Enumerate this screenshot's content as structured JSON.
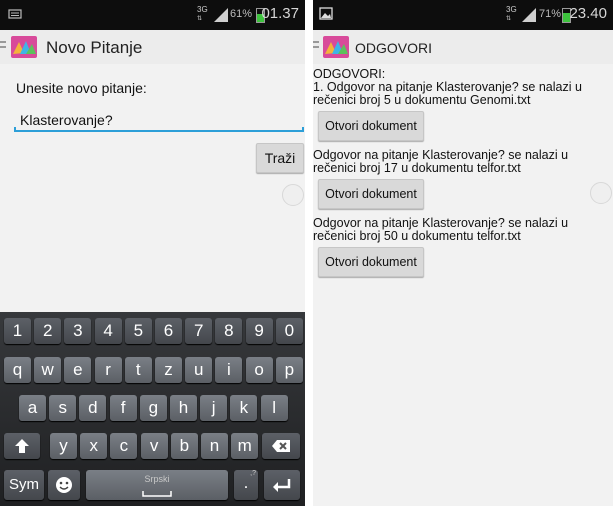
{
  "left_screen": {
    "status": {
      "network": "3G",
      "signal": "signal-bars-icon",
      "battery_pct": "61%",
      "battery_level": 0.61,
      "time": "01.37"
    },
    "action_bar": {
      "title": "Novo Pitanje"
    },
    "prompt_label": "Unesite novo pitanje:",
    "question_input": {
      "value": "Klasterovanje?"
    },
    "search_button": "Traži",
    "keyboard": {
      "number_row": [
        "1",
        "2",
        "3",
        "4",
        "5",
        "6",
        "7",
        "8",
        "9",
        "0"
      ],
      "row1": [
        "q",
        "w",
        "e",
        "r",
        "t",
        "z",
        "u",
        "i",
        "o",
        "p"
      ],
      "row2": [
        "a",
        "s",
        "d",
        "f",
        "g",
        "h",
        "j",
        "k",
        "l"
      ],
      "row3": [
        "y",
        "x",
        "c",
        "v",
        "b",
        "n",
        "m"
      ],
      "shift_key": "shift-arrow-icon",
      "backspace_key": "backspace-icon",
      "sym_label": "Sym",
      "emoji_key": "smiley-icon",
      "space_label": "Srpski",
      "punct_key": ".",
      "punct_sub": ",?",
      "enter_key": "enter-icon"
    }
  },
  "right_screen": {
    "status": {
      "network": "3G",
      "signal": "signal-bars-icon",
      "battery_pct": "71%",
      "battery_level": 0.71,
      "time": "23.40",
      "notification": "image-icon"
    },
    "action_bar": {
      "title": "ODGOVORI"
    },
    "header": "ODGOVORI:",
    "answers": [
      {
        "line1": "1. Odgovor na pitanje Klasterovanje? se nalazi u",
        "line2": "rečenici broj 5 u dokumentu Genomi.txt",
        "button": "Otvori dokument"
      },
      {
        "line1": "Odgovor na pitanje Klasterovanje? se nalazi u",
        "line2": "rečenici broj 17 u dokumentu telfor.txt",
        "button": "Otvori dokument"
      },
      {
        "line1": "Odgovor na pitanje Klasterovanje? se nalazi u",
        "line2": "rečenici broj 50 u dokumentu telfor.txt",
        "button": "Otvori dokument"
      }
    ]
  },
  "colors": {
    "accent": "#2d9fd8",
    "statusbar": "#0d0d0d",
    "battery": "#3dc33d",
    "logo": "#d84a9a"
  }
}
